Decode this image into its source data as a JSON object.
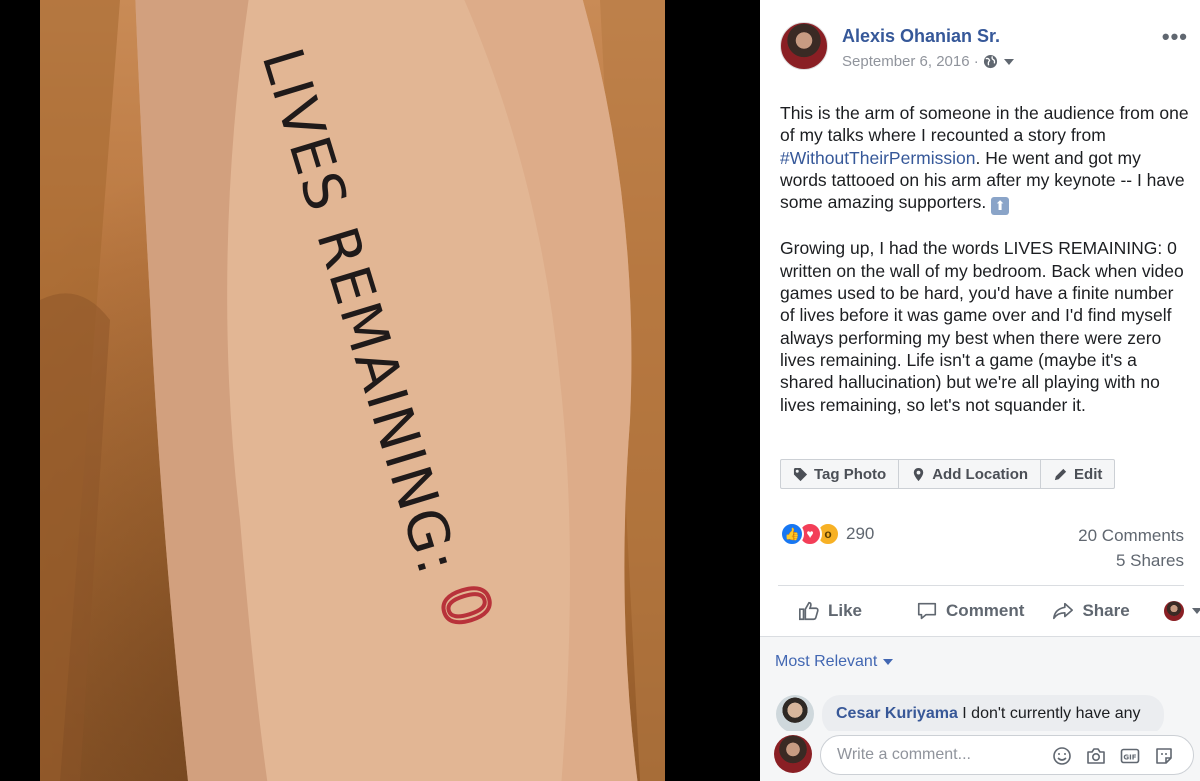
{
  "photo": {
    "tattoo_text": "LIVES REMAINING:",
    "tattoo_digit": "0"
  },
  "post": {
    "author": "Alexis Ohanian Sr.",
    "date": "September 6, 2016 ·",
    "more_label": "•••",
    "paragraph1_before": "This is the arm of someone in the audience from one of my talks where I recounted a story from ",
    "hashtag": "#WithoutTheirPermission",
    "paragraph1_after": ". He went and got my words tattooed on his arm after my keynote -- I have some amazing supporters. ",
    "emoji": "⬆",
    "paragraph2": "Growing up, I had the words LIVES REMAINING: 0 written on the wall of my bedroom. Back when video games used to be hard, you'd have a finite number of lives before it was game over and I'd find myself always performing my best when there were zero lives remaining. Life isn't a game (maybe it's a shared hallucination) but we're all playing with no lives remaining, so let's not squander it."
  },
  "photo_actions": {
    "tag": "Tag Photo",
    "location": "Add Location",
    "edit": "Edit"
  },
  "stats": {
    "reaction_count": "290",
    "comments": "20 Comments",
    "shares": "5 Shares"
  },
  "actions": {
    "like": "Like",
    "comment": "Comment",
    "share": "Share"
  },
  "comments": {
    "sort_label": "Most Relevant",
    "first": {
      "author": "Cesar Kuriyama",
      "text": " I don't currently have any"
    },
    "composer_placeholder": "Write a comment..."
  },
  "colors": {
    "link": "#365899",
    "like": "#1877f2",
    "love": "#f33e58",
    "wow": "#f7b125"
  }
}
